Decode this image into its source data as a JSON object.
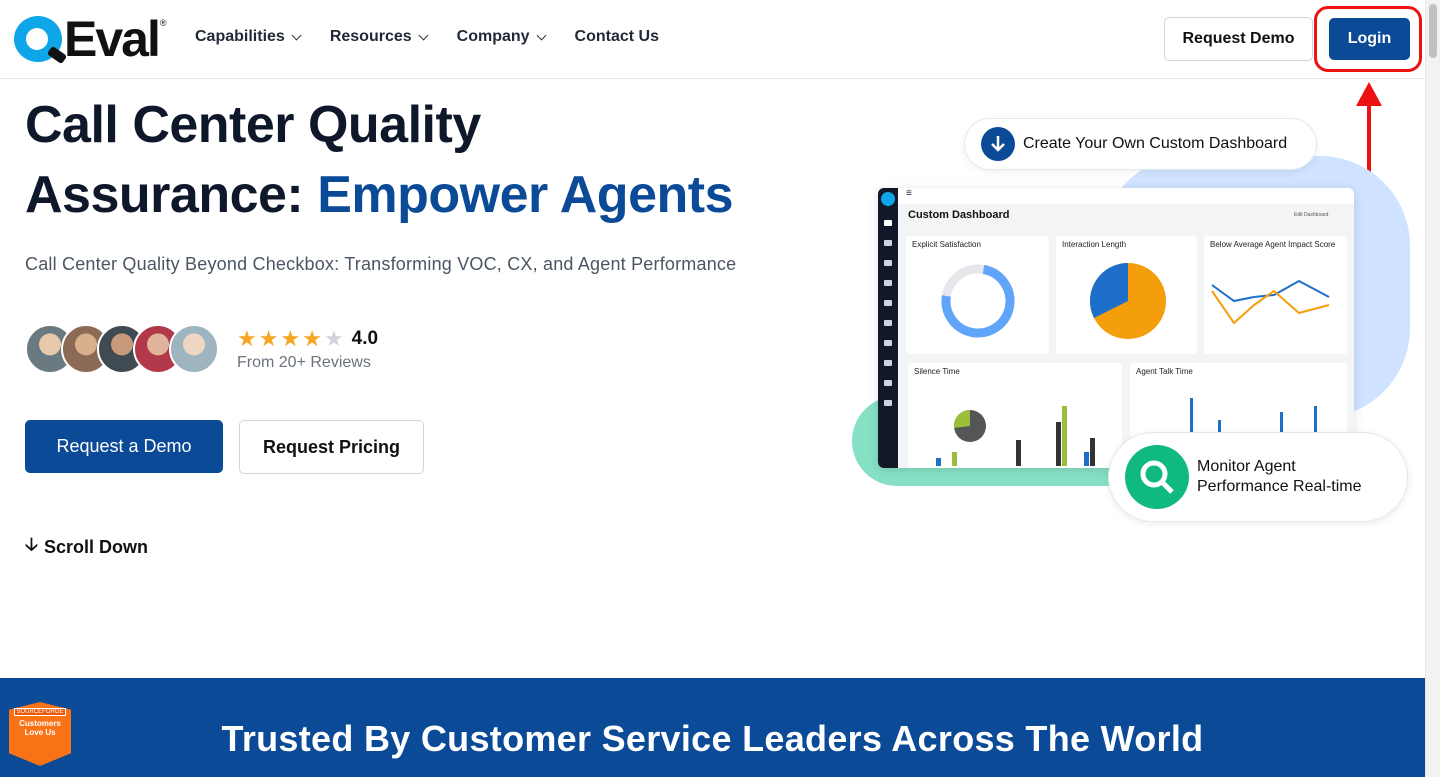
{
  "header": {
    "logo_text": "Eval",
    "nav": [
      {
        "label": "Capabilities",
        "has_dropdown": true
      },
      {
        "label": "Resources",
        "has_dropdown": true
      },
      {
        "label": "Company",
        "has_dropdown": true
      },
      {
        "label": "Contact Us",
        "has_dropdown": false
      }
    ],
    "request_demo_label": "Request Demo",
    "login_label": "Login"
  },
  "hero": {
    "title_line1": "Call Center Quality",
    "title_line2_plain": "Assurance:",
    "title_line2_accent": "Empower Agents",
    "subtitle": "Call Center Quality Beyond Checkbox: Transforming VOC, CX, and Agent Performance",
    "rating": "4.0",
    "stars_filled": 4,
    "stars_total": 5,
    "reviews_text": "From 20+ Reviews",
    "primary_cta": "Request a Demo",
    "secondary_cta": "Request Pricing",
    "scroll_label": "Scroll Down"
  },
  "dashboard": {
    "pill_top": "Create Your Own Custom Dashboard",
    "pill_bottom_line1": "Monitor Agent",
    "pill_bottom_line2": "Performance Real-time",
    "title": "Custom Dashboard",
    "edit_label": "Edit Dashboard",
    "cards": [
      "Explicit Satisfaction",
      "Interaction Length",
      "Below Average Agent Impact Score",
      "Silence Time",
      "Agent Talk Time"
    ]
  },
  "band": {
    "heading": "Trusted By Customer Service Leaders Across The World",
    "badge_line1": "SOURCEFORGE",
    "badge_line2": "Customers Love Us"
  },
  "colors": {
    "brand_blue": "#0a4a96",
    "highlight_red": "#e11111",
    "star": "#f5a623"
  }
}
